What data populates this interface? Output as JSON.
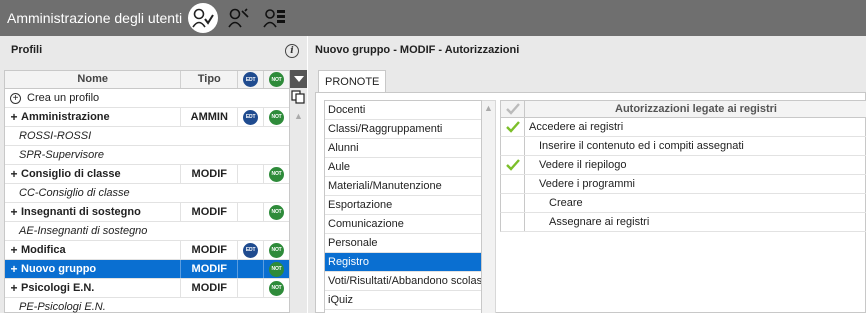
{
  "window": {
    "title": "Amministrazione degli utenti",
    "toolbar_icons": [
      "users-check-icon",
      "user-key-icon",
      "user-list-icon"
    ]
  },
  "left_panel": {
    "title": "Profili",
    "columns": {
      "nome": "Nome",
      "tipo": "Tipo",
      "edt": "EDT",
      "not": "NOT"
    },
    "create_label": "Crea un profilo",
    "rows": [
      {
        "name": "Amministrazione",
        "tipo": "AMMIN",
        "edt": true,
        "not": true,
        "kind": "group"
      },
      {
        "name": "ROSSI-ROSSI",
        "tipo": "",
        "edt": false,
        "not": false,
        "kind": "sub"
      },
      {
        "name": "SPR-Supervisore",
        "tipo": "",
        "edt": false,
        "not": false,
        "kind": "sub"
      },
      {
        "name": "Consiglio di classe",
        "tipo": "MODIF",
        "edt": false,
        "not": true,
        "kind": "group"
      },
      {
        "name": "CC-Consiglio di classe",
        "tipo": "",
        "edt": false,
        "not": false,
        "kind": "sub"
      },
      {
        "name": "Insegnanti di sostegno",
        "tipo": "MODIF",
        "edt": false,
        "not": true,
        "kind": "group"
      },
      {
        "name": "AE-Insegnanti di sostegno",
        "tipo": "",
        "edt": false,
        "not": false,
        "kind": "sub"
      },
      {
        "name": "Modifica",
        "tipo": "MODIF",
        "edt": true,
        "not": true,
        "kind": "group"
      },
      {
        "name": "Nuovo gruppo",
        "tipo": "MODIF",
        "edt": false,
        "not": true,
        "kind": "group",
        "selected": true
      },
      {
        "name": "Psicologi E.N.",
        "tipo": "MODIF",
        "edt": false,
        "not": true,
        "kind": "group"
      },
      {
        "name": "PE-Psicologi E.N.",
        "tipo": "",
        "edt": false,
        "not": false,
        "kind": "sub"
      }
    ]
  },
  "right_panel": {
    "title": "Nuovo gruppo - MODIF - Autorizzazioni",
    "tab": "PRONOTE",
    "categories": [
      "Docenti",
      "Classi/Raggruppamenti",
      "Alunni",
      "Aule",
      "Materiali/Manutenzione",
      "Esportazione",
      "Comunicazione",
      "Personale",
      "Registro",
      "Voti/Risultati/Abbandono scolastico",
      "iQuiz"
    ],
    "selected_category": "Registro",
    "permissions_header": "Autorizzazioni legate ai registri",
    "permissions": [
      {
        "label": "Accedere ai registri",
        "checked": true,
        "level": 0
      },
      {
        "label": "Inserire il contenuto ed i compiti assegnati",
        "checked": false,
        "level": 1
      },
      {
        "label": "Vedere il riepilogo",
        "checked": true,
        "level": 1
      },
      {
        "label": "Vedere i programmi",
        "checked": false,
        "level": 1
      },
      {
        "label": "Creare",
        "checked": false,
        "level": 2
      },
      {
        "label": "Assegnare ai registri",
        "checked": false,
        "level": 2
      }
    ]
  },
  "colors": {
    "titlebar": "#6f6f6f",
    "selection": "#0a6fd1",
    "edt_badge": "#1f4b8f",
    "not_badge": "#2e8b3a",
    "check": "#7cbf2a"
  }
}
